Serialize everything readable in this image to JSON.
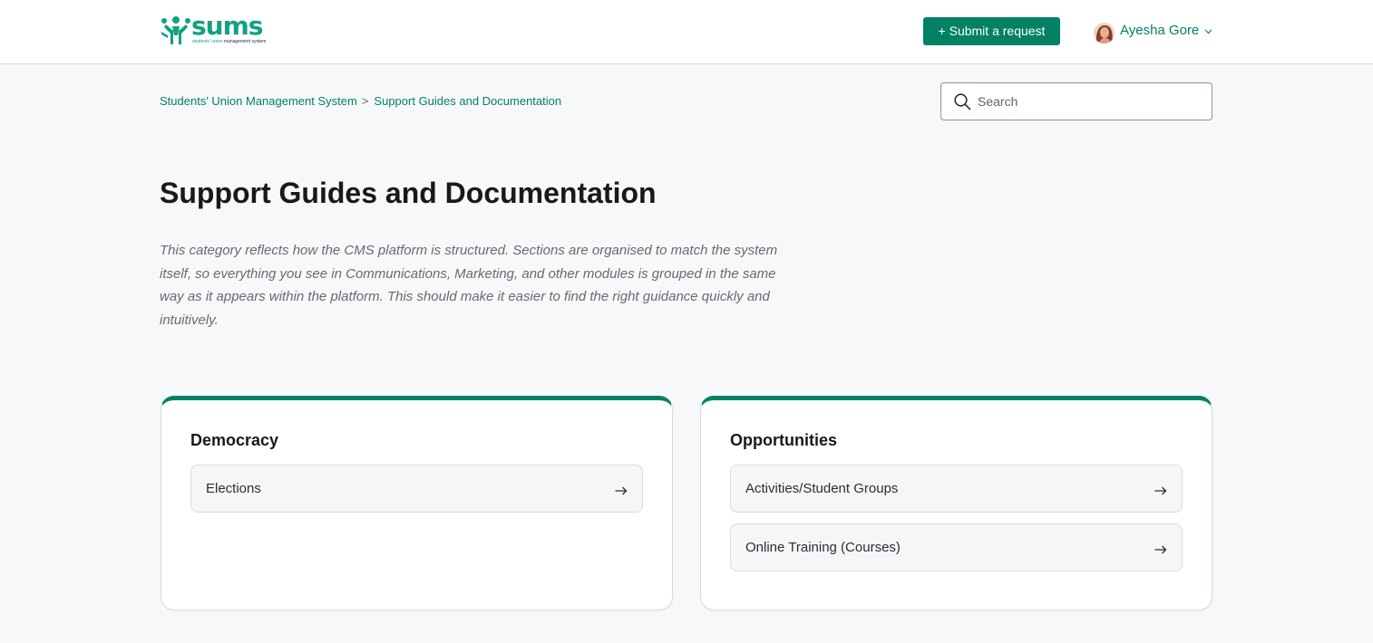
{
  "header": {
    "logo": {
      "wordmark": "sums",
      "tagline_part1": "students' union",
      "tagline_part2": "management system"
    },
    "submit_label": "+ Submit a request",
    "user": {
      "name": "Ayesha Gore"
    }
  },
  "breadcrumb": {
    "items": [
      "Students' Union Management System",
      "Support Guides and Documentation"
    ],
    "separator": ">"
  },
  "search": {
    "placeholder": "Search",
    "value": ""
  },
  "main": {
    "title": "Support Guides and Documentation",
    "description": "This category reflects how the CMS platform is structured. Sections are organised to match the system itself, so everything you see in Communications, Marketing, and other modules is grouped in the same way as it appears within the platform. This should make it easier to find the right guidance quickly and intuitively."
  },
  "cards": [
    {
      "title": "Democracy",
      "sections": [
        "Elections"
      ]
    },
    {
      "title": "Opportunities",
      "sections": [
        "Activities/Student Groups",
        "Online Training (Courses)"
      ]
    }
  ],
  "icons": {
    "search": "search-icon",
    "arrow": "arrow-right-icon",
    "chevron": "chevron-down-icon"
  },
  "colors": {
    "brand": "#038165",
    "logo": "#12a183",
    "background": "#f7f8fa",
    "card_accent": "#038165"
  }
}
